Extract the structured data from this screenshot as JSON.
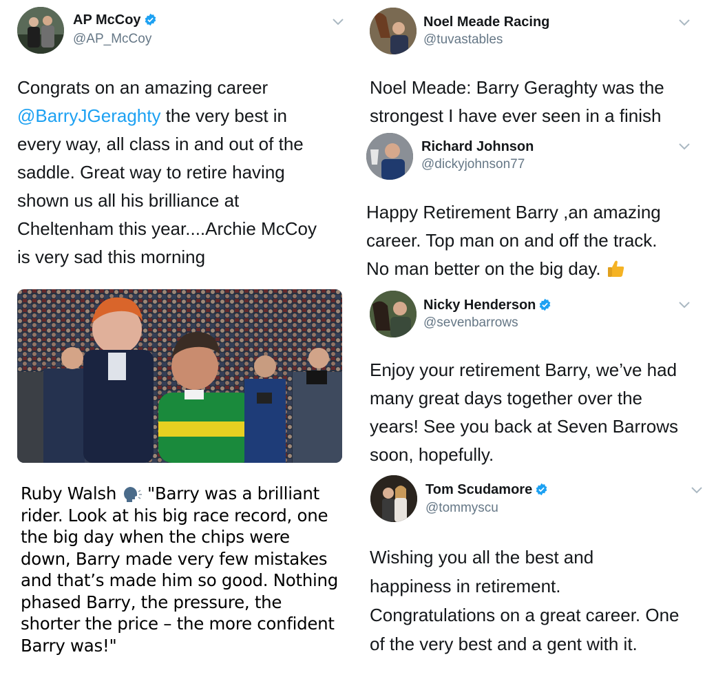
{
  "tweets": {
    "apmccoy": {
      "name": "AP McCoy",
      "handle": "@AP_McCoy",
      "verified": true,
      "text_before": "Congrats on an amazing career",
      "mention": "@BarryJGeraghty",
      "text_after_lines": [
        " the very best in",
        "every way, all class in and out of the",
        "saddle. Great way to retire having",
        "shown us all his brilliance at",
        "Cheltenham this year....Archie McCoy",
        "is very sad this morning"
      ]
    },
    "noelmeade": {
      "name": "Noel Meade Racing",
      "handle": "@tuvastables",
      "verified": false,
      "text_lines": [
        "Noel Meade: Barry Geraghty was the",
        "strongest I have ever seen in a finish"
      ]
    },
    "richardjohnson": {
      "name": "Richard Johnson",
      "handle": "@dickyjohnson77",
      "verified": false,
      "text_lines": [
        "Happy Retirement Barry ,an amazing",
        "career. Top man on and off the track.",
        "No man better on the big day."
      ],
      "emoji": "thumbs-up"
    },
    "nickyhenderson": {
      "name": "Nicky Henderson",
      "handle": "@sevenbarrows",
      "verified": true,
      "text_lines": [
        "Enjoy your retirement Barry, we’ve had",
        "many great days together over the",
        "years! See you back at Seven Barrows",
        "soon, hopefully."
      ]
    },
    "tomscudamore": {
      "name": "Tom Scudamore",
      "handle": "@tommyscu",
      "verified": true,
      "text_lines": [
        "Wishing you all the best and",
        "happiness in retirement.",
        "Congratulations on a great career. One",
        "of the very best and a gent with it."
      ]
    }
  },
  "quote": {
    "speaker": "Ruby Walsh",
    "icon": "speaking-head-icon",
    "text_first": " \"Barry was a brilliant",
    "lines": [
      "rider. Look at his big race record, one",
      "the big day when the chips were",
      "down, Barry made very few mistakes",
      "and that’s made him so good. Nothing",
      "phased Barry, the pressure, the",
      "shorter the price – the more confident",
      "Barry was!\""
    ]
  },
  "colors": {
    "link": "#1da1f2",
    "secondary_text": "#657786",
    "verified_badge": "#1da1f2",
    "chevron": "#aab8c2"
  }
}
